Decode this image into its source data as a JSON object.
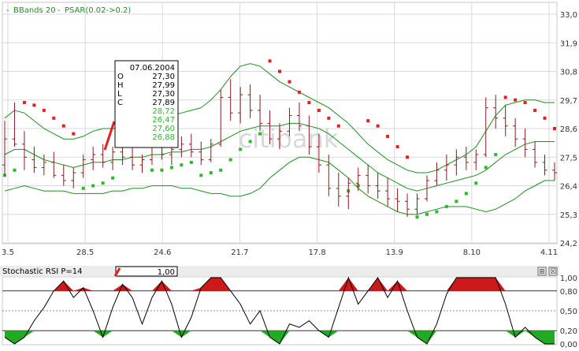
{
  "price_panel": {
    "legend": {
      "bbands_label": "BBands 20",
      "psar_label": "PSAR(0.02->0.2)",
      "separator": "-"
    },
    "watermark": "citibank",
    "tooltip": {
      "date": "07.06.2004",
      "rows": [
        {
          "key": "O",
          "value": "27,30"
        },
        {
          "key": "H",
          "value": "27,99"
        },
        {
          "key": "L",
          "value": "27,30"
        },
        {
          "key": "C",
          "value": "27,89"
        }
      ],
      "indicator_values": [
        "28,72",
        "26,47",
        "27,60",
        "26,88"
      ]
    }
  },
  "stoch_panel": {
    "title": "Stochastic RSI P=14",
    "value_box": "1,00",
    "buttons": [
      "⊞",
      "☒"
    ]
  },
  "colors": {
    "candle": "#8b1a1a",
    "bands": "#1f8f1f",
    "psar_up": "#2db82d",
    "psar_down": "#e61e1e",
    "fill_high": "#cc1a1a",
    "fill_low": "#22aa22",
    "grid": "#d9d9d9"
  },
  "chart_data": [
    {
      "type": "candlestick",
      "title": "",
      "x_ticks": [
        "3.5",
        "28.5",
        "24.6",
        "21.7",
        "17.8",
        "13.9",
        "8.10",
        "4.11"
      ],
      "y_ticks": [
        "24,2",
        "25,3",
        "26,4",
        "27,5",
        "28,6",
        "29,7",
        "30,8",
        "31,9",
        "33,0"
      ],
      "ylim": [
        24.2,
        33.0
      ],
      "ohlc": [
        [
          27.2,
          28.9,
          26.8,
          28.2
        ],
        [
          28.2,
          29.6,
          27.9,
          28.0
        ],
        [
          28.0,
          28.5,
          27.0,
          27.5
        ],
        [
          27.4,
          27.9,
          26.9,
          27.1
        ],
        [
          27.1,
          27.6,
          26.8,
          27.3
        ],
        [
          27.3,
          27.7,
          26.7,
          26.8
        ],
        [
          26.8,
          27.2,
          26.4,
          26.6
        ],
        [
          26.6,
          27.1,
          26.3,
          26.9
        ],
        [
          26.9,
          27.6,
          26.7,
          27.4
        ],
        [
          27.4,
          27.9,
          27.0,
          27.6
        ],
        [
          27.6,
          28.0,
          27.1,
          27.3
        ],
        [
          27.3,
          27.9,
          27.0,
          27.7
        ],
        [
          27.7,
          28.1,
          27.2,
          27.5
        ],
        [
          27.5,
          27.9,
          27.0,
          27.2
        ],
        [
          27.2,
          27.6,
          26.9,
          27.4
        ],
        [
          27.4,
          28.2,
          27.2,
          27.9
        ],
        [
          27.9,
          28.3,
          27.4,
          27.6
        ],
        [
          27.6,
          28.0,
          27.2,
          27.8
        ],
        [
          27.8,
          28.3,
          27.5,
          28.0
        ],
        [
          28.0,
          28.4,
          27.5,
          27.7
        ],
        [
          27.7,
          28.1,
          27.2,
          27.4
        ],
        [
          27.4,
          28.2,
          27.3,
          28.0
        ],
        [
          28.0,
          30.1,
          27.9,
          29.8
        ],
        [
          29.8,
          30.5,
          28.9,
          29.2
        ],
        [
          29.2,
          30.2,
          28.8,
          29.9
        ],
        [
          29.9,
          30.3,
          29.0,
          29.3
        ],
        [
          29.3,
          29.9,
          28.5,
          28.8
        ],
        [
          28.8,
          29.3,
          28.0,
          28.2
        ],
        [
          28.2,
          28.8,
          27.8,
          28.5
        ],
        [
          28.5,
          29.4,
          28.3,
          29.1
        ],
        [
          29.1,
          29.6,
          28.5,
          28.7
        ],
        [
          28.7,
          29.1,
          27.6,
          27.9
        ],
        [
          27.9,
          28.4,
          26.9,
          27.2
        ],
        [
          27.2,
          27.6,
          26.0,
          26.3
        ],
        [
          26.3,
          26.9,
          25.6,
          26.0
        ],
        [
          26.0,
          26.7,
          25.5,
          26.5
        ],
        [
          26.5,
          27.1,
          26.2,
          26.8
        ],
        [
          26.8,
          27.2,
          26.1,
          26.4
        ],
        [
          26.4,
          26.9,
          25.9,
          26.2
        ],
        [
          26.2,
          26.7,
          25.6,
          25.9
        ],
        [
          25.9,
          26.3,
          25.4,
          25.8
        ],
        [
          25.8,
          26.1,
          25.2,
          25.5
        ],
        [
          25.5,
          26.1,
          25.3,
          25.9
        ],
        [
          25.9,
          26.8,
          25.8,
          26.6
        ],
        [
          26.6,
          27.3,
          26.4,
          27.0
        ],
        [
          27.0,
          27.6,
          26.6,
          27.2
        ],
        [
          27.2,
          27.8,
          26.8,
          27.5
        ],
        [
          27.5,
          27.9,
          27.0,
          27.3
        ],
        [
          27.3,
          27.8,
          27.0,
          27.6
        ],
        [
          27.6,
          29.8,
          27.5,
          29.4
        ],
        [
          29.4,
          29.9,
          28.6,
          29.0
        ],
        [
          29.0,
          29.5,
          28.3,
          28.7
        ],
        [
          28.7,
          29.0,
          27.9,
          28.2
        ],
        [
          28.2,
          28.6,
          27.5,
          27.8
        ],
        [
          27.8,
          28.1,
          27.1,
          27.3
        ],
        [
          27.3,
          27.6,
          26.8,
          27.0
        ],
        [
          27.0,
          27.3,
          26.6,
          26.9
        ]
      ],
      "series": [
        {
          "name": "BBands 20",
          "part": "upper",
          "values": [
            29.0,
            29.3,
            29.2,
            28.9,
            28.6,
            28.4,
            28.2,
            28.2,
            28.3,
            28.5,
            28.6,
            28.6,
            28.7,
            28.7,
            28.7,
            28.8,
            28.9,
            29.1,
            29.2,
            29.3,
            29.4,
            29.7,
            30.1,
            30.6,
            31.0,
            31.1,
            31.0,
            30.7,
            30.4,
            30.2,
            30.0,
            29.8,
            29.6,
            29.4,
            29.1,
            28.8,
            28.4,
            28.0,
            27.7,
            27.4,
            27.2,
            27.0,
            26.9,
            26.9,
            27.0,
            27.2,
            27.4,
            27.6,
            27.9,
            28.5,
            29.1,
            29.5,
            29.6,
            29.7,
            29.7,
            29.6,
            29.6
          ]
        },
        {
          "name": "BBands 20",
          "part": "middle",
          "values": [
            27.6,
            27.8,
            27.8,
            27.6,
            27.4,
            27.3,
            27.2,
            27.1,
            27.2,
            27.3,
            27.3,
            27.4,
            27.4,
            27.5,
            27.5,
            27.6,
            27.6,
            27.7,
            27.7,
            27.8,
            27.8,
            27.9,
            28.1,
            28.3,
            28.5,
            28.6,
            28.7,
            28.7,
            28.7,
            28.8,
            28.8,
            28.7,
            28.6,
            28.4,
            28.1,
            27.8,
            27.5,
            27.2,
            26.9,
            26.7,
            26.5,
            26.3,
            26.2,
            26.3,
            26.4,
            26.5,
            26.6,
            26.7,
            26.8,
            27.0,
            27.3,
            27.6,
            27.8,
            28.0,
            28.1,
            28.1,
            28.1
          ]
        },
        {
          "name": "BBands 20",
          "part": "lower",
          "values": [
            26.2,
            26.3,
            26.4,
            26.3,
            26.2,
            26.2,
            26.2,
            26.1,
            26.1,
            26.1,
            26.1,
            26.2,
            26.2,
            26.3,
            26.3,
            26.4,
            26.4,
            26.4,
            26.3,
            26.3,
            26.2,
            26.1,
            26.1,
            26.0,
            26.0,
            26.1,
            26.3,
            26.7,
            27.0,
            27.3,
            27.5,
            27.5,
            27.4,
            27.3,
            27.0,
            26.7,
            26.3,
            26.0,
            25.8,
            25.6,
            25.4,
            25.3,
            25.3,
            25.4,
            25.5,
            25.6,
            25.6,
            25.6,
            25.5,
            25.4,
            25.5,
            25.7,
            25.9,
            26.2,
            26.4,
            26.6,
            26.6
          ]
        },
        {
          "name": "PSAR(0.02->0.2)",
          "values": [
            26.8,
            27.0,
            29.6,
            29.5,
            29.3,
            29.0,
            28.7,
            28.4,
            26.3,
            26.4,
            26.5,
            26.7,
            28.8,
            28.6,
            28.3,
            27.0,
            27.0,
            27.1,
            27.2,
            27.3,
            26.8,
            26.9,
            27.0,
            27.4,
            27.8,
            28.1,
            28.4,
            31.2,
            30.8,
            30.4,
            30.0,
            29.6,
            29.3,
            29.0,
            28.7,
            26.2,
            26.4,
            28.9,
            28.7,
            28.3,
            27.9,
            27.5,
            25.2,
            25.3,
            25.4,
            25.6,
            25.8,
            26.1,
            26.5,
            27.1,
            27.6,
            29.8,
            29.7,
            29.6,
            29.3,
            29.0,
            28.6
          ],
          "direction": [
            "up",
            "up",
            "down",
            "down",
            "down",
            "down",
            "down",
            "down",
            "up",
            "up",
            "up",
            "up",
            "down",
            "down",
            "down",
            "up",
            "up",
            "up",
            "up",
            "up",
            "up",
            "up",
            "up",
            "up",
            "up",
            "up",
            "up",
            "down",
            "down",
            "down",
            "down",
            "down",
            "down",
            "down",
            "down",
            "up",
            "up",
            "down",
            "down",
            "down",
            "down",
            "down",
            "up",
            "up",
            "up",
            "up",
            "up",
            "up",
            "up",
            "up",
            "up",
            "down",
            "down",
            "down",
            "down",
            "down",
            "down"
          ]
        }
      ],
      "legend_position": "top-left",
      "grid": true
    },
    {
      "type": "line",
      "title": "Stochastic RSI P=14",
      "y_ticks": [
        "0,00",
        "0,20",
        "0,50",
        "0,80",
        "1,00"
      ],
      "ylim": [
        0,
        1
      ],
      "reference_lines": [
        0.2,
        0.5,
        0.8
      ],
      "values": [
        0.1,
        0.0,
        0.1,
        0.35,
        0.55,
        0.8,
        0.95,
        0.7,
        0.85,
        0.5,
        0.1,
        0.55,
        0.9,
        0.7,
        0.3,
        0.7,
        0.95,
        0.6,
        0.1,
        0.4,
        0.85,
        1.0,
        1.0,
        0.8,
        0.6,
        0.3,
        0.5,
        0.1,
        0.0,
        0.3,
        0.25,
        0.35,
        0.2,
        0.1,
        0.55,
        1.0,
        0.6,
        0.8,
        1.0,
        0.7,
        0.95,
        0.5,
        0.1,
        0.0,
        0.3,
        0.75,
        1.0,
        1.0,
        1.0,
        1.0,
        1.0,
        0.6,
        0.1,
        0.25,
        0.1,
        0.0,
        0.0
      ],
      "grid": true
    }
  ]
}
